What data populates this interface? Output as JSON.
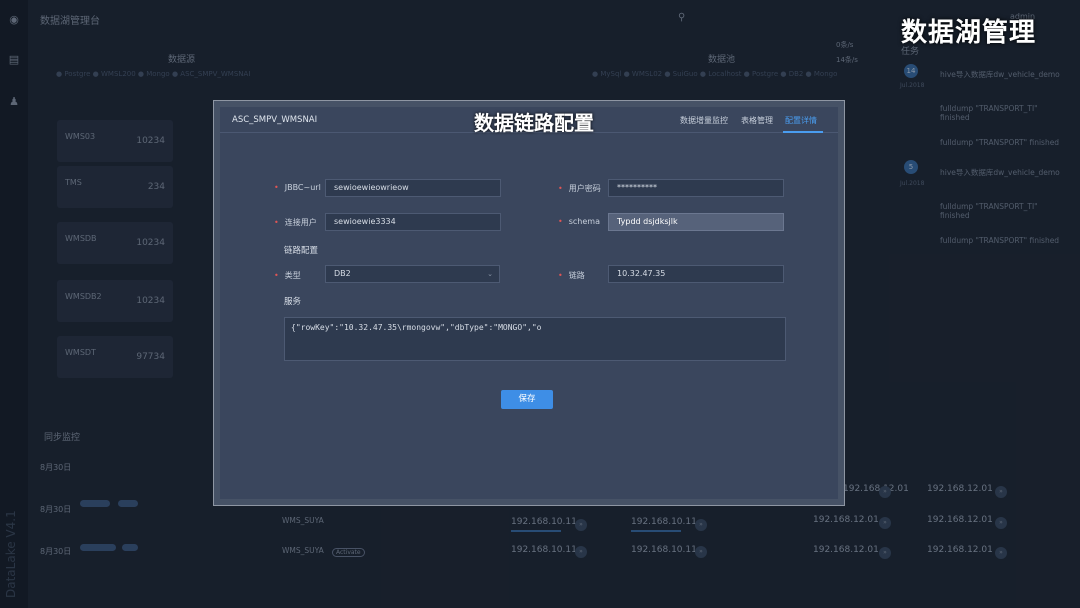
{
  "app": {
    "title": "数据湖管理台",
    "brand": "DataLake V4.1",
    "user": "admin",
    "overlay_title": "数据湖管理"
  },
  "dashboard": {
    "source_header": "数据源",
    "target_header": "数据池",
    "legend_left": "● Postgre   ● WMSL200   ● Mongo   ● ASC_SMPV_WMSNAI",
    "legend_right": "● MySql   ● WMSL02   ● SuiGuo   ● Localhost   ● Postgre   ● DB2   ● Mongo",
    "counts": [
      "0条/s",
      "14条/s"
    ],
    "tasks_header": "任务",
    "sources": [
      {
        "name": "WMS03",
        "value": "10234"
      },
      {
        "name": "TMS",
        "value": "234"
      },
      {
        "name": "WMSDB",
        "value": "10234"
      },
      {
        "name": "WMSDB2",
        "value": "10234"
      },
      {
        "name": "WMSDT",
        "value": "97734"
      }
    ],
    "sync_header": "同步监控",
    "sync_rows": [
      {
        "date": "8月30日"
      },
      {
        "date": "8月30日"
      },
      {
        "date": "8月30日"
      }
    ],
    "sync_mid": [
      {
        "name": "WMS_SUYA",
        "tag": ""
      },
      {
        "name": "WMS_SUYA",
        "tag": "Activate"
      }
    ],
    "ips": [
      "192.168.10.11",
      "192.168.10.11",
      "192.168.10.11",
      "192.168.10.11",
      "192.168.12.01",
      "192.168.12.01",
      "192.168.12.01",
      "192.168.12.01",
      "192.168.12.01",
      "192.168.12.01"
    ],
    "task_list": [
      {
        "date": "Jul.2018",
        "day": "14"
      },
      {
        "date": "Jul.2018",
        "day": "5"
      }
    ],
    "task_items": [
      "hive导入数据库dw_vehicle_demo",
      "fulldump \"TRANSPORT_TI\" finished",
      "fulldump \"TRANSPORT\" finished",
      "hive导入数据库dw_vehicle_demo",
      "fulldump \"TRANSPORT_TI\" finished",
      "fulldump \"TRANSPORT\" finished"
    ]
  },
  "modal": {
    "name": "ASC_SMPV_WMSNAI",
    "title": "数据链路配置",
    "tabs": [
      "数据增量监控",
      "表格管理",
      "配置详情"
    ],
    "active_tab_index": 2,
    "fields": {
      "jdbc_label": "JBBC~url",
      "jdbc_value": "sewioewieowrieow",
      "password_label": "用户密码",
      "password_value": "**********",
      "user_label": "连接用户",
      "user_value": "sewioewie3334",
      "schema_label": "schema",
      "schema_value": "Typdd dsjdksjlk",
      "link_section": "链路配置",
      "type_label": "类型",
      "type_value": "DB2",
      "link_label": "链路",
      "link_value": "10.32.47.35",
      "service_section": "服务",
      "service_value": "{\"rowKey\":\"10.32.47.35\\rmongovw\",\"dbType\":\"MONGO\",\"o"
    },
    "save_label": "保存"
  },
  "colors": {
    "accent": "#3e8ee6",
    "tab_active": "#4a9df0",
    "required": "#e05555"
  }
}
